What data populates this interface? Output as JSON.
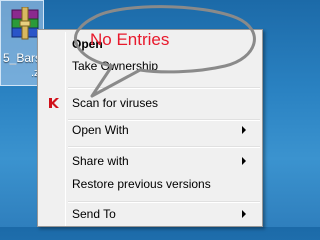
{
  "desktop": {
    "icon_name": "winrar-archive-icon",
    "label_line1": "5_Bars",
    "label_line2": ".z"
  },
  "annotation": {
    "text": "No Entries",
    "color": "#e8192c"
  },
  "context_menu": {
    "items": [
      {
        "label": "Open",
        "bold": true,
        "submenu": false
      },
      {
        "label": "Take Ownership",
        "submenu": false
      },
      {
        "label": "Scan for viruses",
        "icon": "kaspersky-icon",
        "submenu": false
      },
      {
        "label": "Open With",
        "submenu": true
      },
      {
        "label": "Share with",
        "submenu": true
      },
      {
        "label": "Restore previous versions",
        "submenu": false
      },
      {
        "label": "Send To",
        "submenu": true
      }
    ]
  }
}
